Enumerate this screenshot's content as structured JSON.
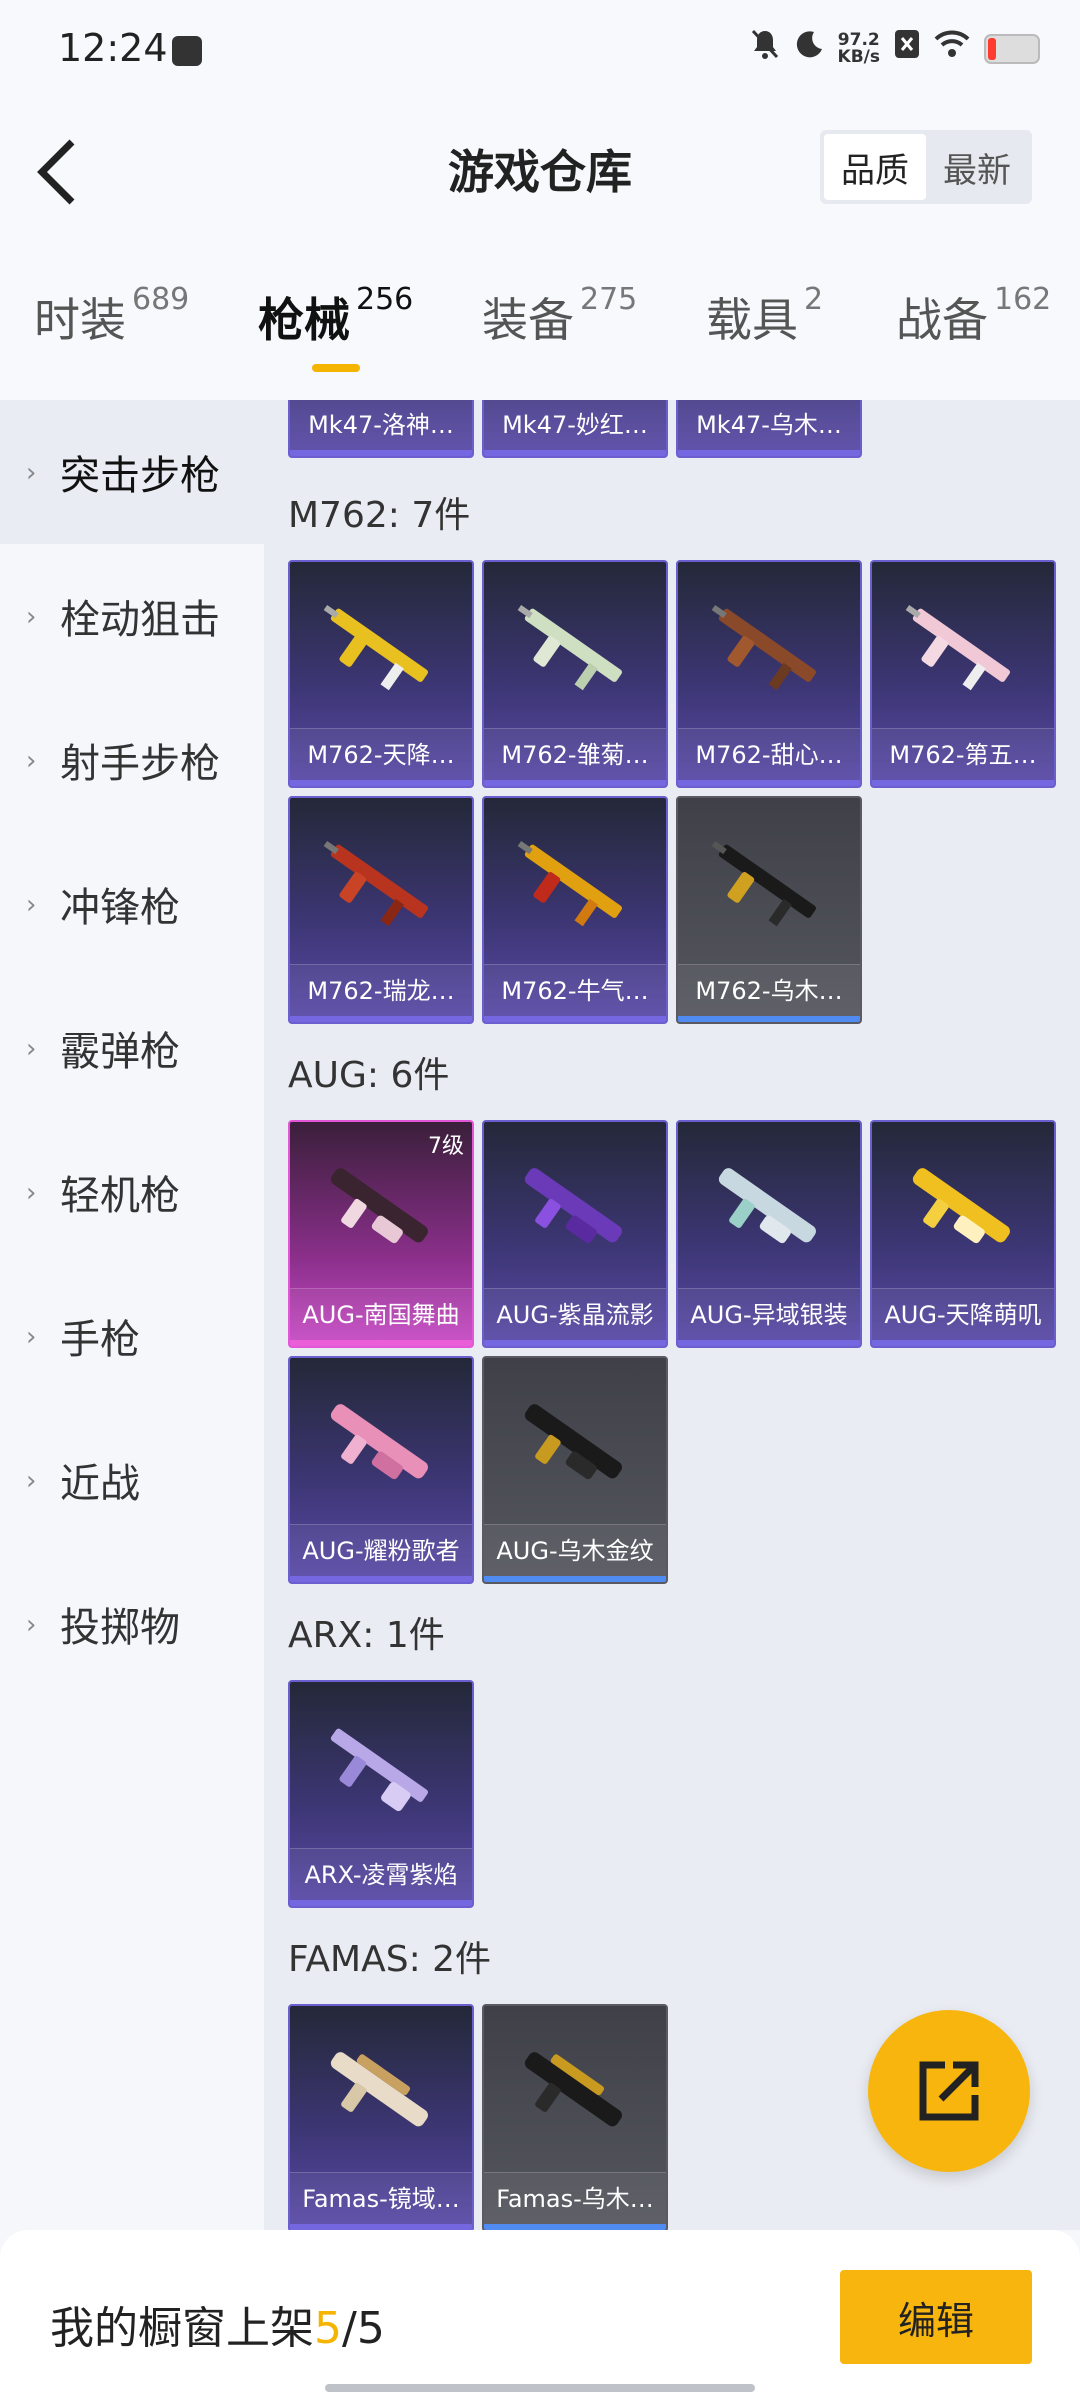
{
  "status": {
    "time": "12:24",
    "net_speed_value": "97.2",
    "net_speed_unit": "KB/s"
  },
  "header": {
    "title": "游戏仓库",
    "sort_options": [
      "品质",
      "最新"
    ],
    "tabs": [
      {
        "label": "时装",
        "count": "689"
      },
      {
        "label": "枪械",
        "count": "256"
      },
      {
        "label": "装备",
        "count": "275"
      },
      {
        "label": "载具",
        "count": "2"
      },
      {
        "label": "战备",
        "count": "162"
      }
    ]
  },
  "sidebar": {
    "items": [
      "突击步枪",
      "栓动狙击",
      "射手步枪",
      "冲锋枪",
      "霰弹枪",
      "轻机枪",
      "手枪",
      "近战",
      "投掷物"
    ]
  },
  "sections": [
    {
      "title": "",
      "items": [
        {
          "name": "Mk47-洛神…"
        },
        {
          "name": "Mk47-妙红…"
        },
        {
          "name": "Mk47-乌木…"
        }
      ]
    },
    {
      "title": "M762: 7件",
      "items": [
        {
          "name": "M762-天降…"
        },
        {
          "name": "M762-雏菊…"
        },
        {
          "name": "M762-甜心…"
        },
        {
          "name": "M762-第五…"
        },
        {
          "name": "M762-瑞龙…"
        },
        {
          "name": "M762-牛气…"
        },
        {
          "name": "M762-乌木…"
        }
      ]
    },
    {
      "title": "AUG: 6件",
      "items": [
        {
          "name": "AUG-南国舞曲",
          "level": "7级"
        },
        {
          "name": "AUG-紫晶流影"
        },
        {
          "name": "AUG-异域银装"
        },
        {
          "name": "AUG-天降萌叽"
        },
        {
          "name": "AUG-耀粉歌者"
        },
        {
          "name": "AUG-乌木金纹"
        }
      ]
    },
    {
      "title": "ARX: 1件",
      "items": [
        {
          "name": "ARX-凌霄紫焰"
        }
      ]
    },
    {
      "title": "FAMAS: 2件",
      "items": [
        {
          "name": "Famas-镜域…"
        },
        {
          "name": "Famas-乌木…"
        }
      ]
    }
  ],
  "bottom": {
    "showcase_label": "我的橱窗上架",
    "showcase_current": "5",
    "showcase_total": "/5",
    "edit_label": "编辑"
  }
}
